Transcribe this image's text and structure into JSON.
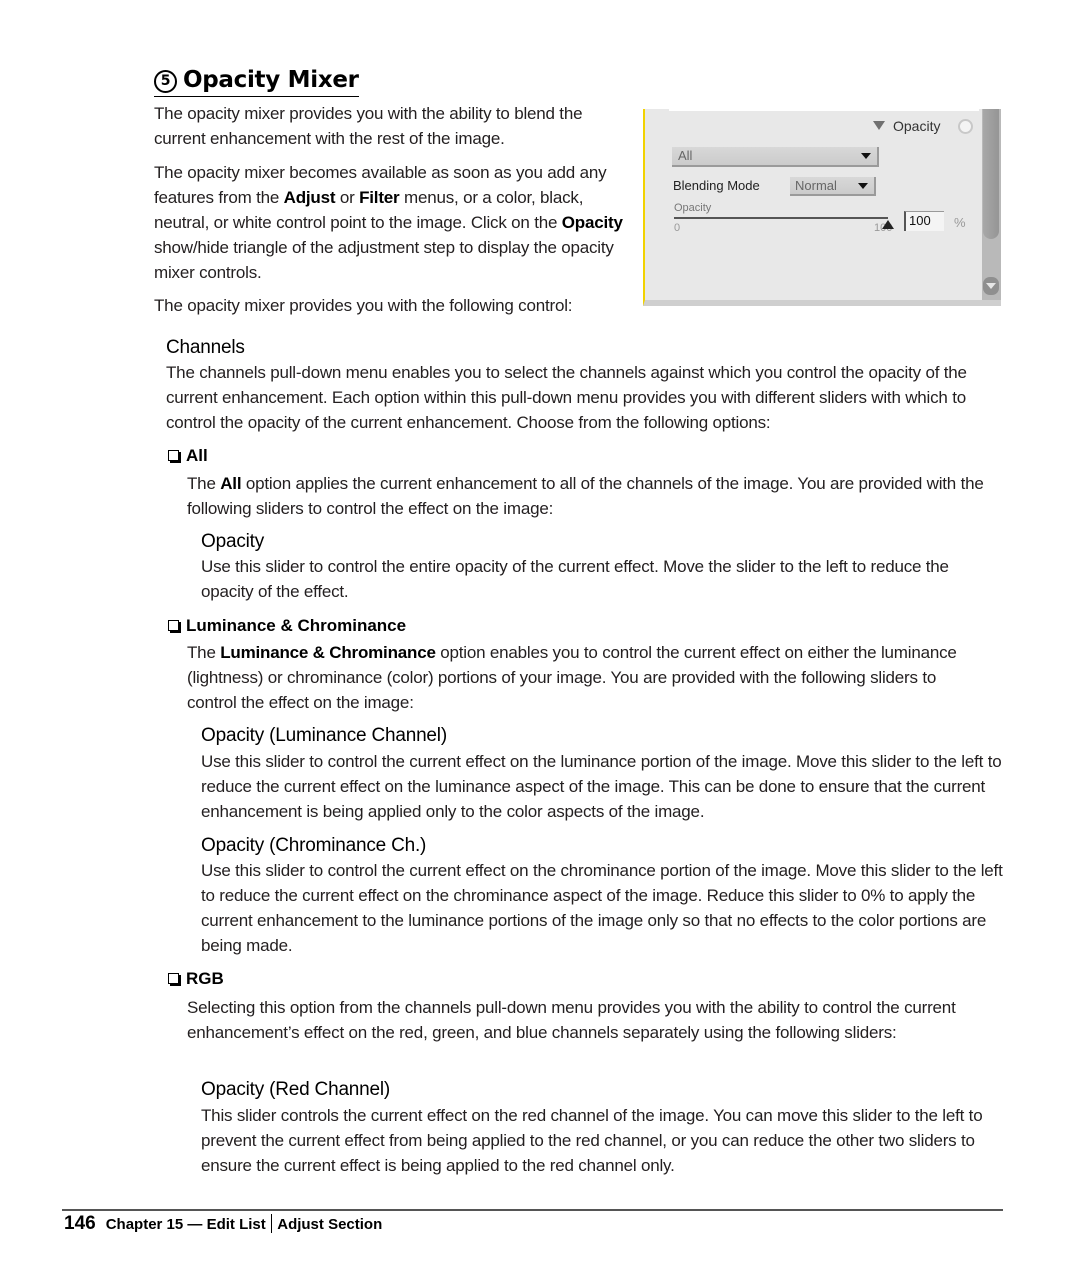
{
  "section": {
    "number": "5",
    "title": "Opacity Mixer"
  },
  "intro": {
    "p1": "The opacity mixer provides you with the ability to blend the current enhancement with the rest of the image.",
    "p2_a": "The opacity mixer becomes available as soon as you add any features from the ",
    "p2_adjust": "Adjust",
    "p2_b": " or ",
    "p2_filter": "Filter",
    "p2_c": " menus, or a color, black, neutral, or white control point to the image. Click on the ",
    "p2_opacity": "Opacity",
    "p2_d": " show/hide triangle of the adjustment step to display the opacity mixer controls.",
    "p3": "The opacity mixer provides you with the following control:"
  },
  "panel": {
    "header_label": "Opacity",
    "channels_value": "All",
    "blending_label": "Blending Mode",
    "blending_value": "Normal",
    "slider_label": "Opacity",
    "slider_min": "0",
    "slider_max": "100",
    "slider_value_fraction": 1.0,
    "value_input": "100",
    "unit": "%"
  },
  "channels": {
    "heading": "Channels",
    "description": "The channels pull-down menu enables you to select the channels against which you control the opacity of the current enhancement. Each option within this pull-down menu provides you with different sliders with which to control the opacity of the current enhancement. Choose from the following options:"
  },
  "options": {
    "all": {
      "heading": "All",
      "desc_a": "The ",
      "desc_bold": "All",
      "desc_b": " option applies the current enhancement to all of the channels of the image. You are provided with the following sliders to control the effect on the image:",
      "sliders": [
        {
          "name": "Opacity",
          "desc": "Use this slider to control the entire opacity of the current effect. Move the slider to the left to reduce the opacity of the effect."
        }
      ]
    },
    "lumchrom": {
      "heading": "Luminance & Chrominance",
      "desc_a": "The ",
      "desc_bold": "Luminance & Chrominance",
      "desc_b": " option enables you to control the current effect on either the luminance (lightness) or chrominance (color) portions of your image. You are provided with the following sliders to control the effect on the image:",
      "sliders": [
        {
          "name": "Opacity (Luminance Channel)",
          "desc": "Use this slider to control the current effect on the luminance portion of the image. Move this slider to the left to reduce the current effect on the luminance aspect of the image. This can be done to ensure that the current enhancement is being applied only to the color aspects of the image."
        },
        {
          "name": "Opacity (Chrominance Ch.)",
          "desc": "Use this slider to control the current effect on the chrominance portion of the image. Move this slider to the left to reduce the current effect on the chrominance aspect of the image. Reduce this slider to 0% to apply the current enhancement to the luminance portions of the image only so that no effects to the color portions are being made."
        }
      ]
    },
    "rgb": {
      "heading": "RGB",
      "desc": "Selecting this option from the channels pull-down menu provides you with the ability to control the current enhancement’s effect on the red, green, and blue channels separately using the following sliders:",
      "sliders": [
        {
          "name": "Opacity (Red Channel)",
          "desc": "This slider controls the current effect on the red channel of the image. You can move this slider to the left to prevent the current effect from being applied to the red channel, or you can reduce the other two sliders to ensure the current effect is being applied to the red channel only."
        }
      ]
    }
  },
  "footer": {
    "page_number": "146",
    "chapter": "Chapter 15 — Edit List",
    "section": "Adjust Section"
  }
}
